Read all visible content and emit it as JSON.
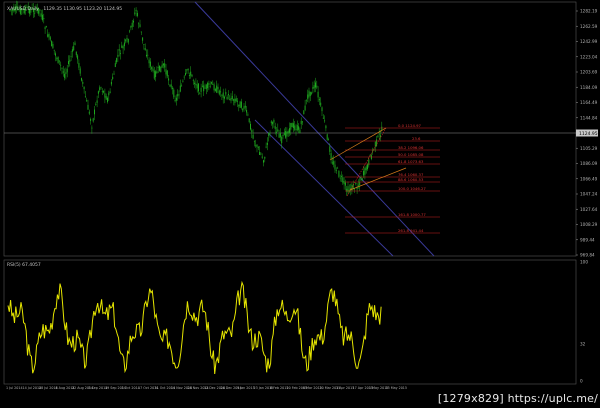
{
  "header": {
    "symbol_label": "XAUUSD,Daily",
    "ohlc": "1129.35 1130.95 1123.20 1124.95"
  },
  "colors": {
    "background": "#000000",
    "candles": "#1faa1f",
    "channel": "#3a3a9a",
    "fib": "#cc2222",
    "rsi": "#e6e600",
    "axis": "#b0b0b0",
    "current_line": "#909090"
  },
  "chart_data": [
    {
      "type": "candlestick",
      "y_ticks": [
        "1282.19",
        "1262.59",
        "1242.99",
        "1223.04",
        "1203.69",
        "1184.09",
        "1164.49",
        "1144.84",
        "1124.95",
        "1105.29",
        "1086.09",
        "1066.49",
        "1047.24",
        "1027.64",
        "1008.29",
        "989.44",
        "969.84"
      ],
      "current_price": "1124.95",
      "fib_levels": [
        {
          "label": "0.0 1124.97"
        },
        {
          "label": "23.6"
        },
        {
          "label": "38.2 1096.06"
        },
        {
          "label": "50.0 1085.08"
        },
        {
          "label": "61.8 1073.63"
        },
        {
          "label": "76.4 1060.37"
        },
        {
          "label": "88.6 1060.53"
        },
        {
          "label": "100.0 1046.27"
        },
        {
          "label": "161.8 1000.77"
        },
        {
          "label": "261.8 941.44"
        }
      ]
    },
    {
      "type": "line",
      "indicator_label": "RSI(5) 67.4057",
      "y_ticks": [
        "100",
        "32",
        "0"
      ],
      "ylim": [
        0,
        100
      ]
    }
  ],
  "x_axis_labels": [
    "1 Jul 2014",
    "14 Jul 2014",
    "28 Jul 2014",
    "8 Aug 2014",
    "22 Aug 2014",
    "5 Sep 2014",
    "19 Sep 2014",
    "3 Oct 2014",
    "17 Oct 2014",
    "31 Oct 2014",
    "14 Nov 2014",
    "28 Nov 2014",
    "12 Dec 2014",
    "26 Dec 2014",
    "9 Jan 2015",
    "23 Jan 2015",
    "6 Feb 2015",
    "20 Feb 2015",
    "6 Mar 2015",
    "20 Mar 2015",
    "3 Apr 2015",
    "17 Apr 2015",
    "1 May 2015",
    "15 May 2015"
  ],
  "watermark": "[1279x829] https://uplc.me/"
}
